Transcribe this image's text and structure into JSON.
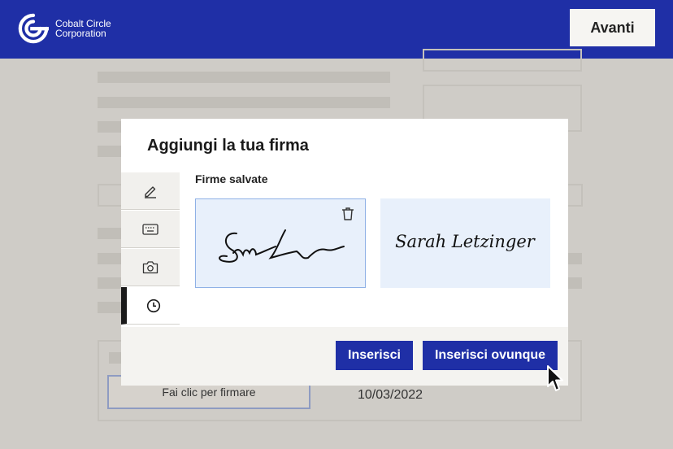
{
  "header": {
    "company_line1": "Cobalt Circle",
    "company_line2": "Corporation",
    "next_button": "Avanti",
    "brand_color": "#1f2fa6"
  },
  "document": {
    "sign_button": "Fai clic per firmare",
    "date": "10/03/2022"
  },
  "modal": {
    "title": "Aggiungi la tua firma",
    "tabs": [
      {
        "icon": "pen-icon",
        "active": false
      },
      {
        "icon": "keyboard-icon",
        "active": false
      },
      {
        "icon": "camera-icon",
        "active": false
      },
      {
        "icon": "clock-icon",
        "active": true
      }
    ],
    "saved_label": "Firme salvate",
    "signatures": [
      {
        "name": "signature-initials",
        "selected": true
      },
      {
        "name": "signature-full",
        "text": "Sarah Letzinger",
        "selected": false
      }
    ],
    "insert_button": "Inserisci",
    "insert_everywhere_button": "Inserisci ovunque"
  }
}
